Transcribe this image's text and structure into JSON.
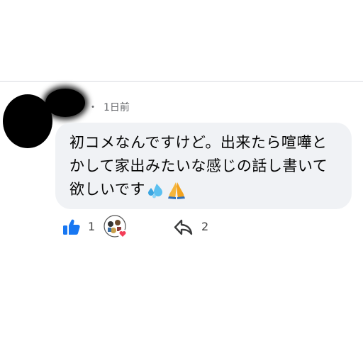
{
  "comment": {
    "timestamp": "1日前",
    "separator": "・",
    "text": "初コメなんですけど。出来たら喧嘩とかして家出みたいな感じの話し書いて欲しいです"
  },
  "actions": {
    "like_count": "1",
    "share_count": "2"
  },
  "colors": {
    "like_blue": "#1877f2",
    "bubble_bg": "#f0f2f5",
    "meta_gray": "#65676b",
    "heart_red": "#f33e58"
  },
  "icons": [
    "like-icon",
    "reactor-avatar",
    "heart-icon",
    "share-icon",
    "sweat-droplets-icon",
    "folded-hands-icon"
  ]
}
